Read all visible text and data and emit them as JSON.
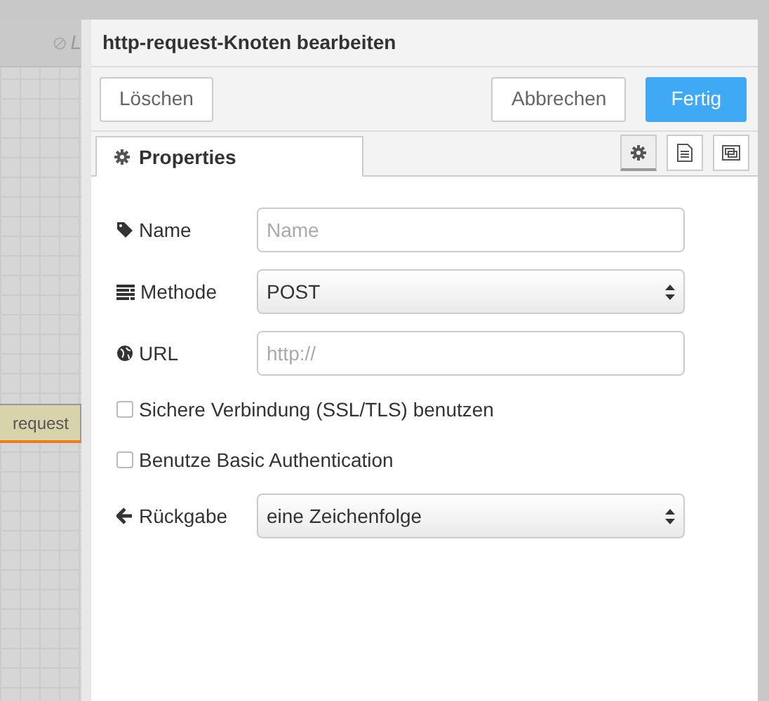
{
  "canvas": {
    "tab_label": "L",
    "node_label": "request"
  },
  "dialog": {
    "title": "http-request-Knoten bearbeiten",
    "buttons": [
      {
        "label": "Löschen",
        "kind": "plain"
      },
      {
        "label": "Abbrechen",
        "kind": "plain"
      },
      {
        "label": "Fertig",
        "kind": "primary"
      }
    ],
    "tabs": [
      {
        "label": "Properties",
        "selected": true
      }
    ],
    "tab_icons": [
      {
        "kind": "gear",
        "selected": true
      },
      {
        "kind": "document",
        "selected": false
      },
      {
        "kind": "frame",
        "selected": false
      }
    ],
    "fields": [
      {
        "kind": "input",
        "label": "Name",
        "placeholder": "Name"
      },
      {
        "kind": "select",
        "label": "Methode",
        "value": "POST"
      },
      {
        "kind": "input",
        "label": "URL",
        "placeholder": "http://"
      },
      {
        "kind": "checkbox",
        "label": "Sichere Verbindung (SSL/TLS) benutzen",
        "checked": false
      },
      {
        "kind": "checkbox",
        "label": "Benutze Basic Authentication",
        "checked": false
      },
      {
        "kind": "select",
        "label": "Rückgabe",
        "value": "eine Zeichenfolge"
      }
    ]
  }
}
